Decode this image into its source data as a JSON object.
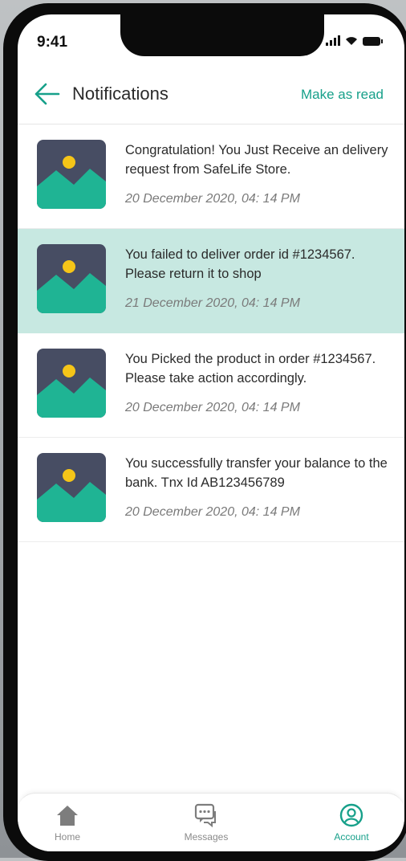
{
  "status": {
    "time": "9:41"
  },
  "header": {
    "title": "Notifications",
    "action": "Make as read"
  },
  "notifications": [
    {
      "message": "Congratulation! You Just Receive an delivery request from SafeLife Store.",
      "date": "20 December 2020, 04: 14 PM",
      "highlighted": false
    },
    {
      "message": "You failed to deliver order id #1234567. Please return it to shop",
      "date": "21 December 2020, 04: 14 PM",
      "highlighted": true
    },
    {
      "message": "You Picked the product in order #1234567. Please take action accordingly.",
      "date": "20 December 2020, 04: 14 PM",
      "highlighted": false
    },
    {
      "message": "You successfully transfer your balance to the bank. Tnx Id AB123456789",
      "date": "20 December 2020, 04: 14 PM",
      "highlighted": false
    }
  ],
  "tabbar": {
    "home": {
      "label": "Home",
      "icon": "home-icon"
    },
    "messages": {
      "label": "Messages",
      "icon": "chat-icon"
    },
    "account": {
      "label": "Account",
      "icon": "account-icon",
      "active": true
    }
  },
  "colors": {
    "accent": "#17a08a",
    "highlight": "#c7e8e1",
    "thumb_bg": "#474d63",
    "thumb_hill": "#1fb494",
    "sun": "#f5c518"
  }
}
